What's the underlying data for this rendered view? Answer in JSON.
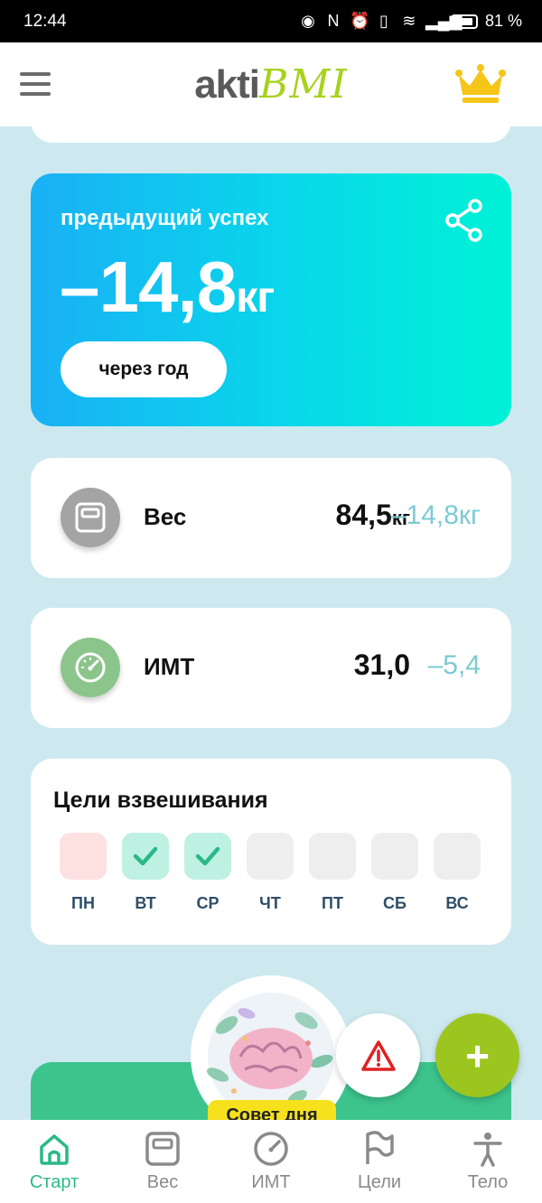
{
  "status_bar": {
    "time": "12:44",
    "battery_percent": "81 %"
  },
  "app_bar": {
    "logo_left": "akti",
    "logo_right": "BMI"
  },
  "success_card": {
    "label": "предыдущий успех",
    "value": "–14,8",
    "unit": "кг",
    "period_button": "через год"
  },
  "weight_card": {
    "name": "Вес",
    "value": "84,5",
    "value_unit": "кг",
    "delta": "–14,8",
    "delta_unit": "кг"
  },
  "bmi_card": {
    "name": "ИМТ",
    "value": "31,0",
    "delta": "–5,4"
  },
  "goals_card": {
    "title": "Цели взвешивания",
    "days": [
      {
        "label": "ПН",
        "state": "missed"
      },
      {
        "label": "ВТ",
        "state": "done"
      },
      {
        "label": "СР",
        "state": "done"
      },
      {
        "label": "ЧТ",
        "state": "empty"
      },
      {
        "label": "ПТ",
        "state": "empty"
      },
      {
        "label": "СБ",
        "state": "empty"
      },
      {
        "label": "ВС",
        "state": "empty"
      }
    ]
  },
  "tip": {
    "label": "Совет дня"
  },
  "fab": {
    "add_label": "+"
  },
  "bottom_nav": {
    "items": [
      {
        "label": "Старт",
        "icon": "home-icon",
        "active": true
      },
      {
        "label": "Вес",
        "icon": "scale-icon",
        "active": false
      },
      {
        "label": "ИМТ",
        "icon": "gauge-icon",
        "active": false
      },
      {
        "label": "Цели",
        "icon": "flag-icon",
        "active": false
      },
      {
        "label": "Тело",
        "icon": "body-icon",
        "active": false
      }
    ]
  },
  "colors": {
    "background": "#cde9ef",
    "accent_green": "#2cb889",
    "fab_green": "#9cc51f",
    "delta_teal": "#7ccbd3",
    "gradient_start": "#1ab0f5",
    "gradient_end": "#00f2d6"
  }
}
